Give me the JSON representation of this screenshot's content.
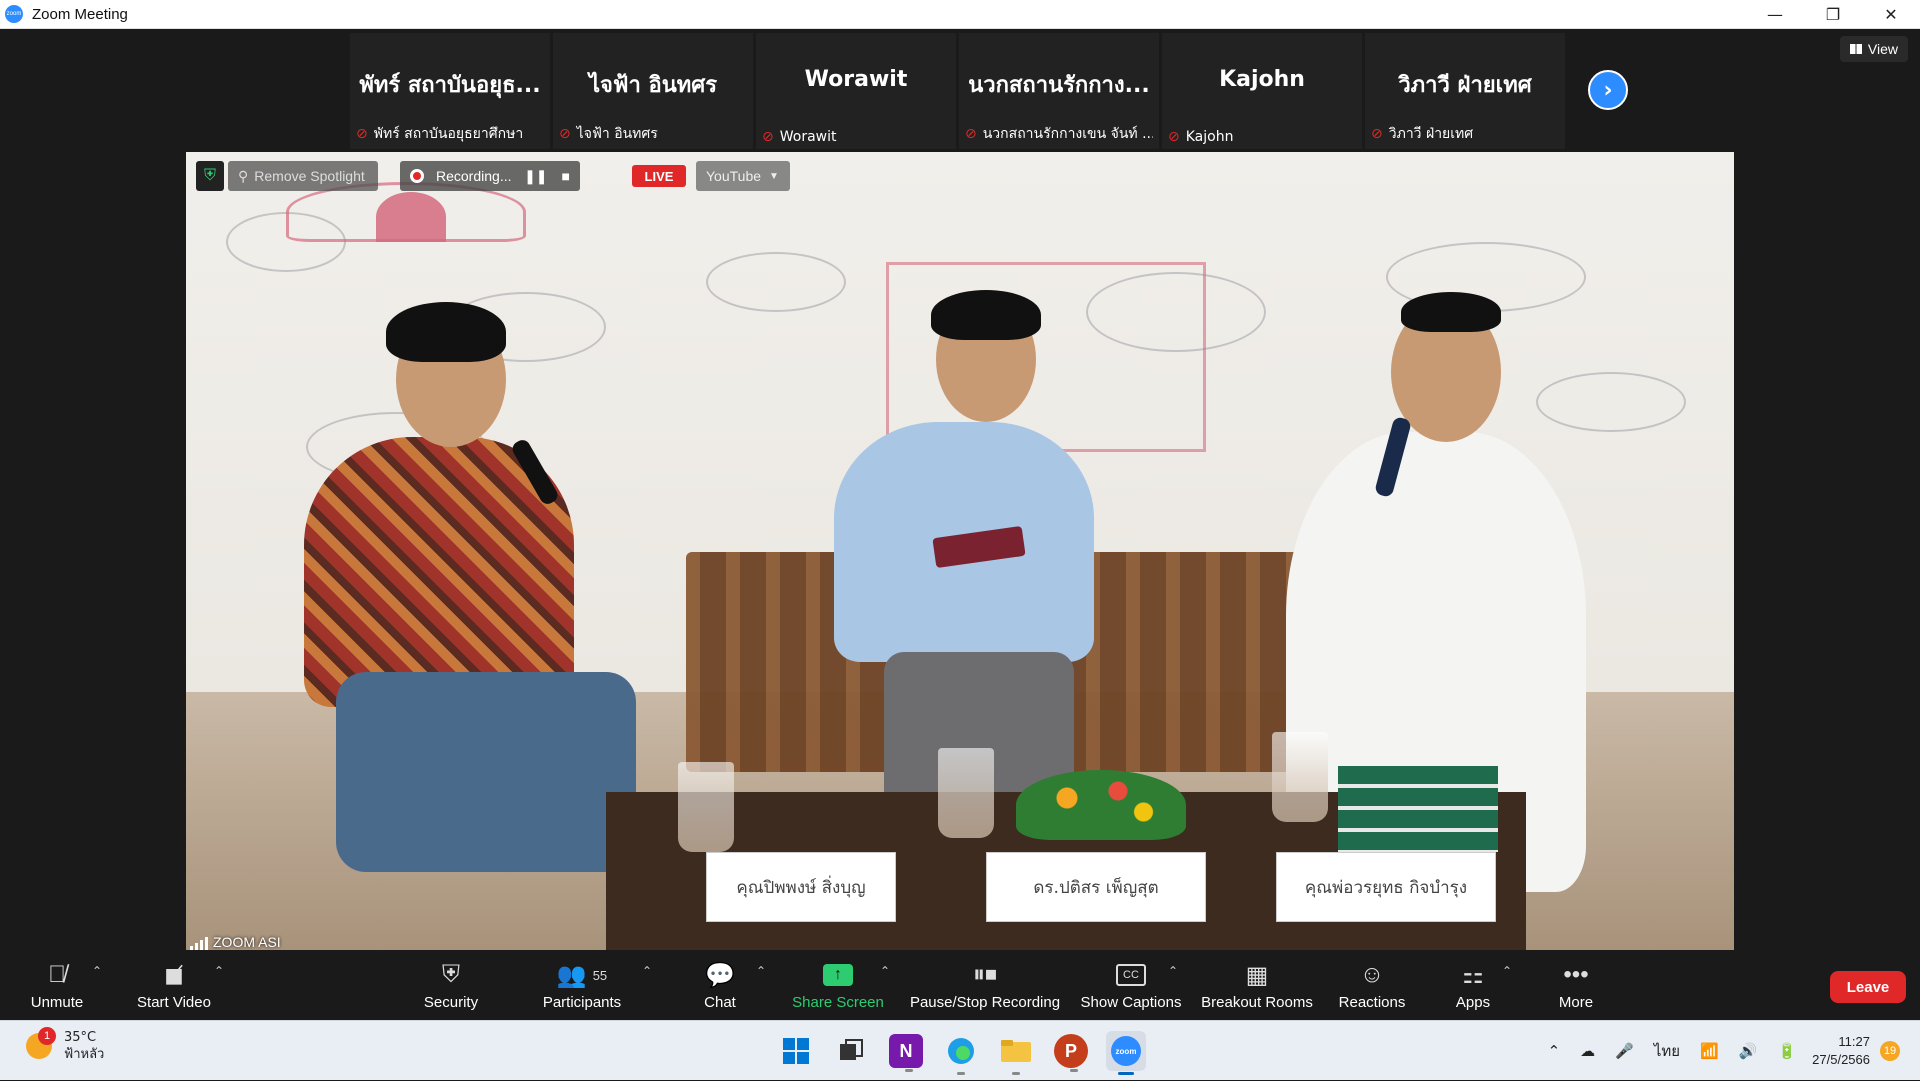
{
  "window": {
    "title": "Zoom Meeting",
    "app_icon": "zoom",
    "controls": {
      "minimize": "—",
      "restore": "❐",
      "close": "✕"
    }
  },
  "view_button": {
    "label": "View"
  },
  "participants_strip": [
    {
      "big_name": "พัทร์ สถาบันอยุธ...",
      "small_name": "พัทร์ สถาบันอยุธยาศึกษา",
      "muted": true
    },
    {
      "big_name": "ไจฟ้า อินทศร",
      "small_name": "ไจฟ้า อินทศร",
      "muted": true
    },
    {
      "big_name": "Worawit",
      "small_name": "Worawit",
      "muted": true
    },
    {
      "big_name": "นวกสถานรักกาง...",
      "small_name": "นวกสถานรักกางเขน จันท์ ...",
      "muted": true
    },
    {
      "big_name": "Kajohn",
      "small_name": "Kajohn",
      "muted": true
    },
    {
      "big_name": "วิภาวี ฝ่ายเทศ",
      "small_name": "วิภาวี ฝ่ายเทศ",
      "muted": true
    }
  ],
  "video_overlay": {
    "spotlight_label": "Remove Spotlight",
    "recording_label": "Recording...",
    "live_label": "LIVE",
    "stream_target": "YouTube",
    "source_label": "ZOOM ASI"
  },
  "nameplates": [
    "คุณปิพพงษ์ สิ่งบุญ",
    "ดร.ปติสร เพ็ญสุต",
    "คุณพ่อวรยุทธ กิจบำรุง"
  ],
  "toolbar": {
    "unmute": "Unmute",
    "start_video": "Start Video",
    "security": "Security",
    "participants": "Participants",
    "participants_count": "55",
    "chat": "Chat",
    "share_screen": "Share Screen",
    "pause_stop_recording": "Pause/Stop Recording",
    "show_captions": "Show Captions",
    "cc_icon_text": "CC",
    "breakout_rooms": "Breakout Rooms",
    "reactions": "Reactions",
    "apps": "Apps",
    "more": "More",
    "leave": "Leave"
  },
  "taskbar": {
    "weather_temp": "35°C",
    "weather_desc": "ฟ้าหลัว",
    "weather_badge": "1",
    "apps": [
      "windows-start",
      "task-view",
      "onenote",
      "edge",
      "file-explorer",
      "powerpoint",
      "zoom"
    ],
    "onenote_letter": "N",
    "powerpoint_letter": "P",
    "zoom_text": "zoom",
    "language": "ไทย",
    "time": "11:27",
    "date": "27/5/2566",
    "notification_count": "19"
  },
  "colors": {
    "zoom_blue": "#2d8cff",
    "live_red": "#e02828",
    "share_green": "#2ecc71",
    "meeting_bg": "#1a1a1a"
  }
}
